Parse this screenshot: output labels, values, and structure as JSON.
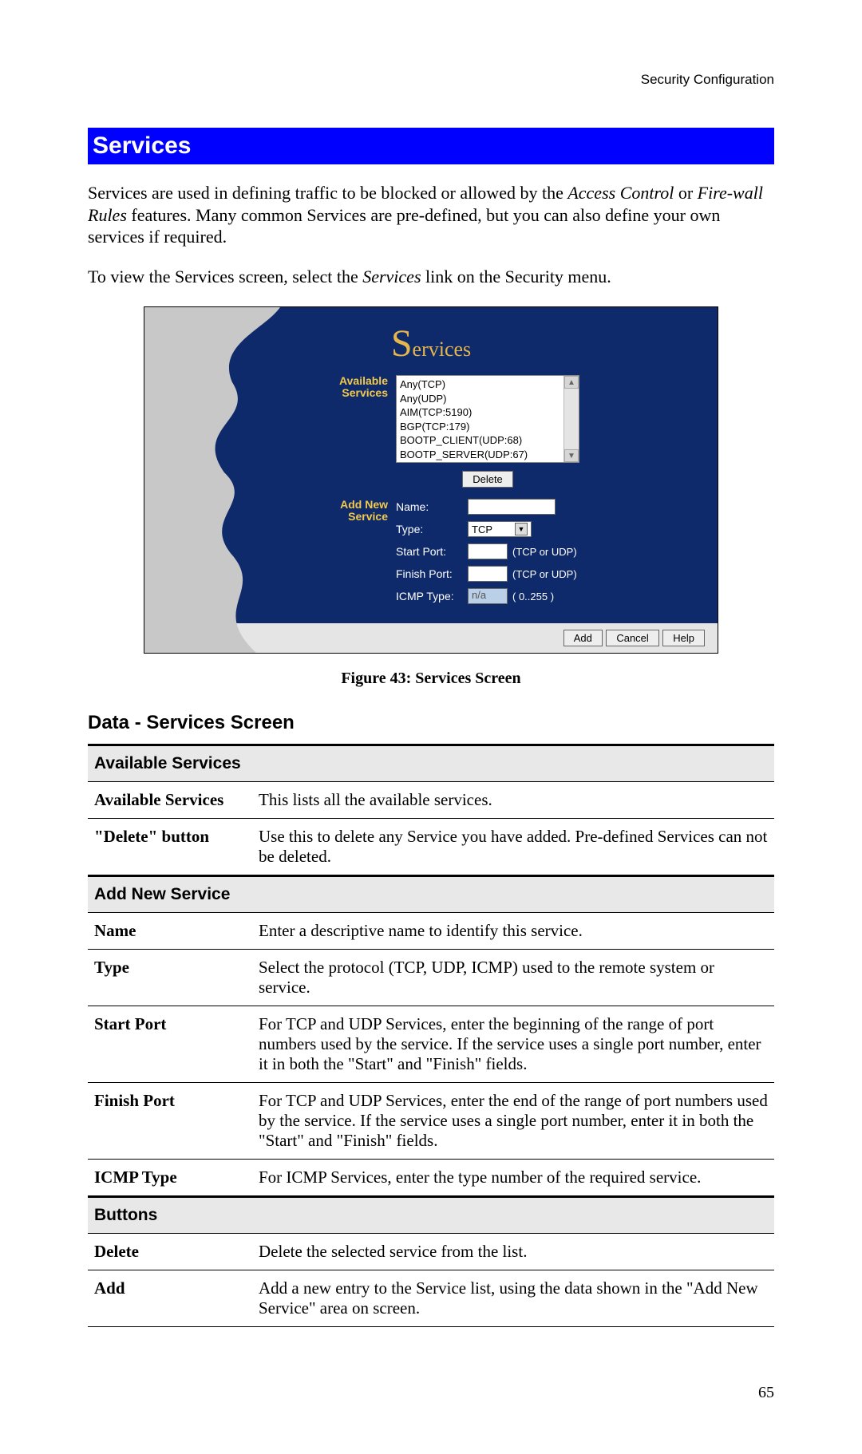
{
  "header_right": "Security Configuration",
  "banner": "Services",
  "intro_parts": {
    "p1_a": "Services are used in defining traffic to be blocked or allowed by the ",
    "p1_b": "Access Control",
    "p1_c": " or ",
    "p1_d": "Fire-wall Rules",
    "p1_e": " features. Many common Services are pre-defined, but you can also define your own services if required.",
    "p2_a": "To view the Services screen, select the ",
    "p2_b": "Services",
    "p2_c": " link on the Security menu."
  },
  "screenshot": {
    "title_big": "S",
    "title_rest": "ervices",
    "labels": {
      "available_services": "Available Services",
      "add_new_service": "Add New Service",
      "name": "Name:",
      "type": "Type:",
      "start_port": "Start Port:",
      "finish_port": "Finish Port:",
      "icmp_type": "ICMP Type:"
    },
    "list_items": [
      "Any(TCP)",
      "Any(UDP)",
      "AIM(TCP:5190)",
      "BGP(TCP:179)",
      "BOOTP_CLIENT(UDP:68)",
      "BOOTP_SERVER(UDP:67)"
    ],
    "delete_btn": "Delete",
    "type_value": "TCP",
    "port_hint": "(TCP or UDP)",
    "icmp_value": "n/a",
    "icmp_hint": "( 0..255 )",
    "buttons": {
      "add": "Add",
      "cancel": "Cancel",
      "help": "Help"
    }
  },
  "figure_caption": "Figure 43: Services Screen",
  "subhead": "Data - Services Screen",
  "table": {
    "sec1": "Available Services",
    "r_avail_label": "Available Services",
    "r_avail_desc": "This lists all the available services.",
    "r_delbtn_label": "\"Delete\" button",
    "r_delbtn_desc": "Use this to delete any Service you have added. Pre-defined Services can not be deleted.",
    "sec2": "Add New Service",
    "r_name_label": "Name",
    "r_name_desc": "Enter a descriptive name to identify this service.",
    "r_type_label": "Type",
    "r_type_desc": "Select the protocol (TCP, UDP, ICMP) used to the remote system or service.",
    "r_start_label": "Start Port",
    "r_start_desc": "For TCP and UDP Services, enter the beginning of the range of port numbers used by the service. If the service uses a single port number, enter it in both the \"Start\" and \"Finish\" fields.",
    "r_finish_label": "Finish Port",
    "r_finish_desc": "For TCP and UDP Services, enter the end of the range of port numbers used by the service. If the service uses a single port number, enter it in both the \"Start\" and \"Finish\" fields.",
    "r_icmp_label": "ICMP Type",
    "r_icmp_desc": "For ICMP Services, enter the type number of the required service.",
    "sec3": "Buttons",
    "r_del_label": "Delete",
    "r_del_desc": "Delete the selected service from the list.",
    "r_add_label": "Add",
    "r_add_desc": "Add a new entry to the Service list, using the data shown in the \"Add New Service\" area on screen."
  },
  "page_number": "65"
}
